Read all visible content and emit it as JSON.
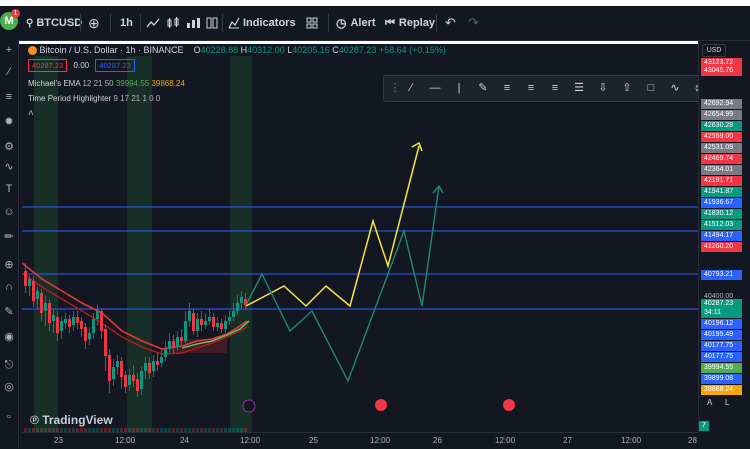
{
  "header": {
    "logo_letter": "M",
    "notification_count": "1",
    "symbol": "BTCUSD",
    "interval": "1h",
    "indicators_label": "Indicators",
    "alert_label": "Alert",
    "replay_label": "Replay"
  },
  "legend": {
    "title": "Bitcoin / U.S. Dollar · 1h · BINANCE",
    "o_label": "O",
    "o_value": "40228.88",
    "h_label": "H",
    "h_value": "40312.00",
    "l_label": "L",
    "l_value": "40205.16",
    "c_label": "C",
    "c_value": "40287.23",
    "change": "+58.64 (+0.15%)",
    "sell_price": "40287.23",
    "spread": "0.00",
    "buy_price": "40287.23",
    "ema_name": "Michael's EMA",
    "ema_params": "12 21 50",
    "ema_v1": "39994.55",
    "ema_v2": "39868.24",
    "tph_name": "Time Period Highlighter",
    "tph_params": "9 17 21 1 0 0"
  },
  "currency": "USD",
  "price_axis": [
    {
      "label": "43123.72",
      "bg": "#f23645"
    },
    {
      "label": "43045.76",
      "bg": "#f23645"
    },
    {
      "label": "42692.94",
      "bg": "#787b86"
    },
    {
      "label": "42654.99",
      "bg": "#787b86"
    },
    {
      "label": "42630.28",
      "bg": "#089981"
    },
    {
      "label": "42559.00",
      "bg": "#f23645"
    },
    {
      "label": "42531.09",
      "bg": "#787b86"
    },
    {
      "label": "42469.74",
      "bg": "#f23645"
    },
    {
      "label": "42364.01",
      "bg": "#787b86"
    },
    {
      "label": "42191.71",
      "bg": "#f23645"
    },
    {
      "label": "41941.87",
      "bg": "#089981"
    },
    {
      "label": "41936.67",
      "bg": "#2962ff"
    },
    {
      "label": "41830.12",
      "bg": "#089981"
    },
    {
      "label": "41512.03",
      "bg": "#089981"
    },
    {
      "label": "41494.17",
      "bg": "#2962ff"
    },
    {
      "label": "41260.20",
      "bg": "#f23645"
    },
    {
      "label": "40793.21",
      "bg": "#2962ff"
    },
    {
      "label": "40400.00",
      "bg": "transparent"
    },
    {
      "label": "40287.23",
      "bg": "#089981"
    },
    {
      "label": "34:11",
      "bg": "#089981"
    },
    {
      "label": "40196.12",
      "bg": "#2962ff"
    },
    {
      "label": "40195.49",
      "bg": "#2962ff"
    },
    {
      "label": "40177.75",
      "bg": "#2962ff"
    },
    {
      "label": "40177.75",
      "bg": "#2962ff"
    },
    {
      "label": "39994.55",
      "bg": "#4caf50"
    },
    {
      "label": "39899.08",
      "bg": "#2962ff"
    },
    {
      "label": "39868.24",
      "bg": "#f7a600"
    }
  ],
  "time_axis": [
    "23",
    "12:00",
    "24",
    "12:00",
    "25",
    "12:00",
    "26",
    "12:00",
    "27",
    "12:00",
    "28"
  ],
  "auto_label": "A",
  "log_label": "L",
  "tz_badge": "7",
  "watermark": "TradingView",
  "colors": {
    "up": "#089981",
    "down": "#f23645",
    "accent": "#2962ff",
    "path_yellow": "#f5e642",
    "path_green": "#26a69a"
  }
}
